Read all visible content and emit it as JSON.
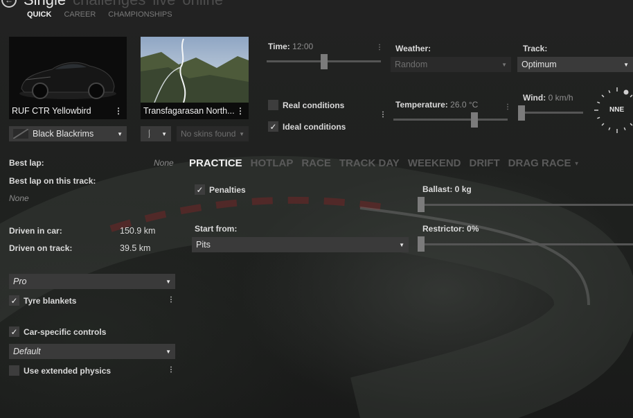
{
  "header": {
    "tabs": [
      "Single",
      "challenges",
      "live",
      "online"
    ],
    "subnav": [
      "QUICK",
      "CAREER",
      "CHAMPIONSHIPS"
    ]
  },
  "car": {
    "name": "RUF CTR Yellowbird",
    "skin": "Black Blackrims"
  },
  "track": {
    "name": "Transfagarasan North...",
    "layout_value": "",
    "skins": "No skins found"
  },
  "time": {
    "label": "Time:",
    "value": "12:00",
    "level": 0.5
  },
  "weather": {
    "label": "Weather:",
    "value": "Random"
  },
  "track_state": {
    "label": "Track:",
    "value": "Optimum"
  },
  "conditions": {
    "real": "Real conditions",
    "ideal": "Ideal conditions",
    "real_checked": false,
    "ideal_checked": true
  },
  "temperature": {
    "label": "Temperature:",
    "value": "26.0 °C",
    "level": 0.72
  },
  "wind": {
    "label": "Wind:",
    "value": "0 km/h",
    "direction": "NNE",
    "level": 0.0
  },
  "stats": {
    "best_lap_label": "Best lap:",
    "best_lap_value": "None",
    "best_lap_track_label": "Best lap on this track:",
    "best_lap_track_value": "None",
    "driven_car_label": "Driven in car:",
    "driven_car_value": "150.9 km",
    "driven_track_label": "Driven on track:",
    "driven_track_value": "39.5 km"
  },
  "assists": {
    "preset": "Pro",
    "tyre_blankets": "Tyre blankets",
    "tyre_blankets_checked": true,
    "car_specific": "Car-specific controls",
    "car_specific_checked": true,
    "controls": "Default",
    "extended_physics": "Use extended physics",
    "extended_physics_checked": false
  },
  "modes": [
    "PRACTICE",
    "HOTLAP",
    "RACE",
    "TRACK DAY",
    "WEEKEND",
    "DRIFT",
    "DRAG RACE"
  ],
  "practice": {
    "penalties": "Penalties",
    "penalties_checked": true,
    "start_from_label": "Start from:",
    "start_from_value": "Pits",
    "ballast_label": "Ballast: 0 kg",
    "ballast_level": 0.0,
    "restrictor_label": "Restrictor: 0%",
    "restrictor_level": 0.0
  },
  "colors": {
    "accent": "#f2f2f2",
    "control_bg": "#3a3a3a",
    "muted": "#8e8e8e"
  }
}
